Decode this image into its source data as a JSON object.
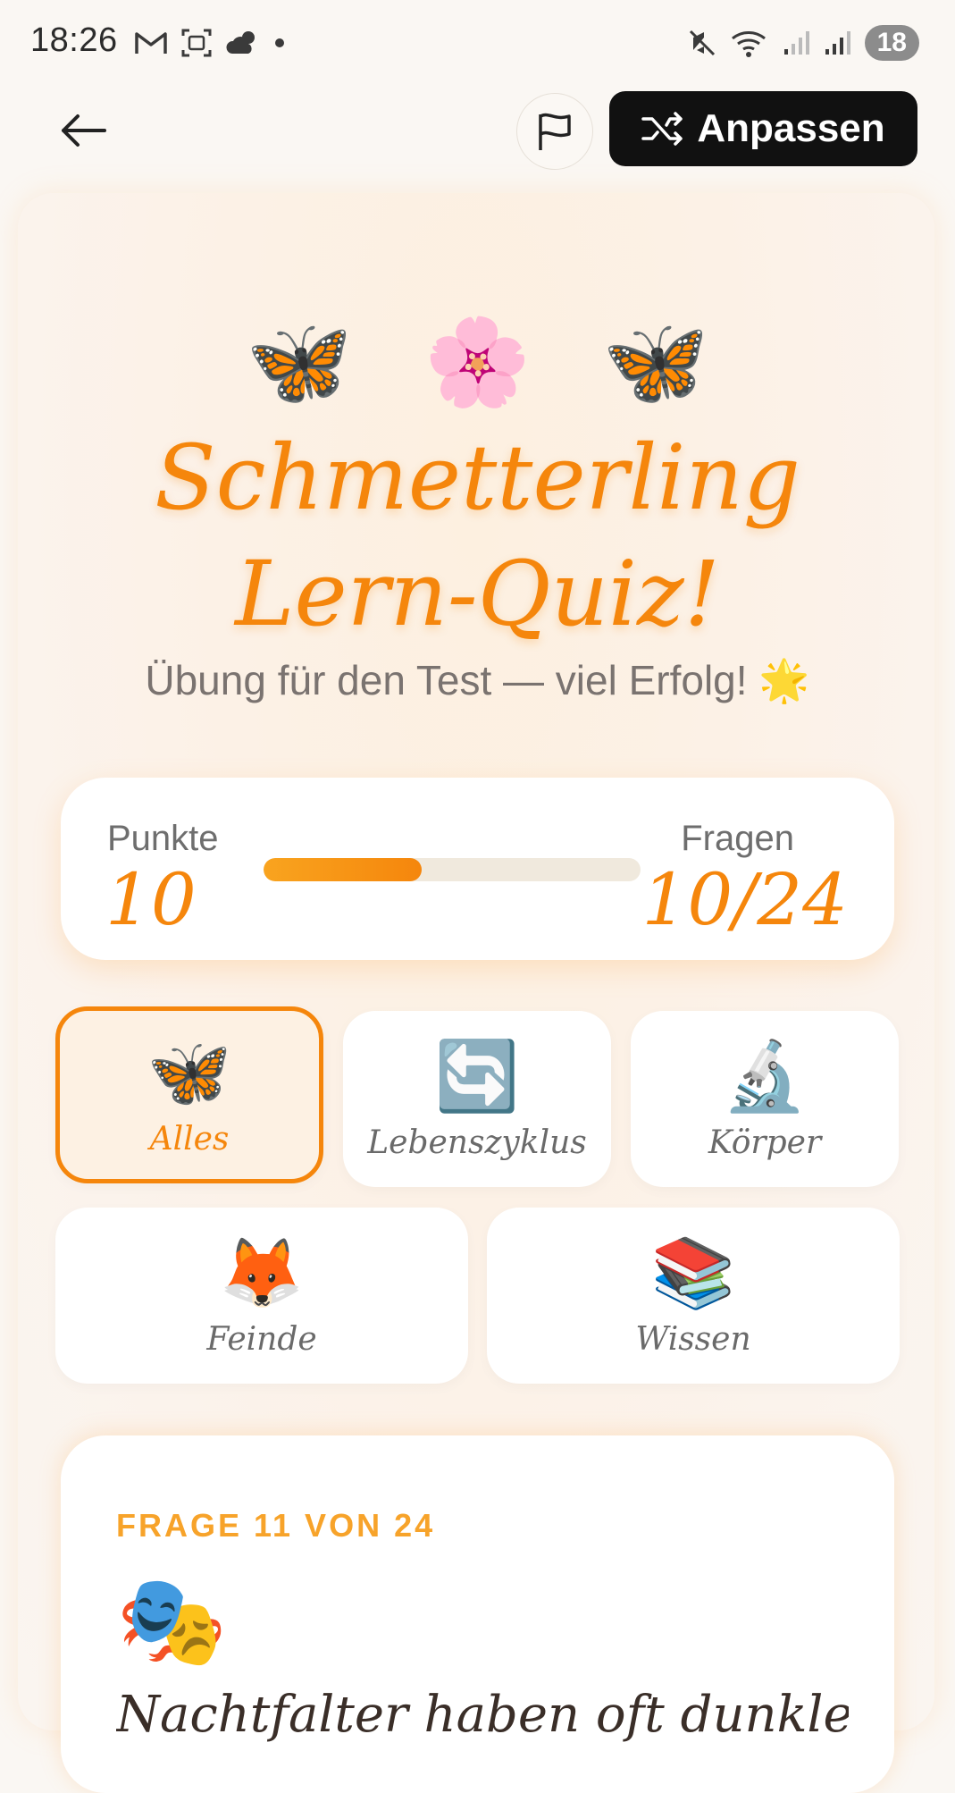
{
  "status_bar": {
    "time": "18:26",
    "battery": "18",
    "left_icons": [
      "gmail-icon",
      "screenshot-icon",
      "weather-icon",
      "dot-icon"
    ],
    "right_icons": [
      "mute-icon",
      "wifi-icon",
      "signal-icon",
      "signal-icon"
    ]
  },
  "topbar": {
    "customize_label": "Anpassen"
  },
  "hero": {
    "emojis": [
      "🦋",
      "🌸",
      "🦋"
    ],
    "title_line1": "Schmetterling",
    "title_line2": "Lern-Quiz!",
    "subtitle": "Übung für den Test — viel Erfolg! 🌟"
  },
  "score": {
    "points_label": "Punkte",
    "points_value": "10",
    "questions_label": "Fragen",
    "questions_value": "10/24",
    "progress_fraction": 0.42
  },
  "categories": [
    {
      "icon": "🦋",
      "label": "Alles",
      "selected": true
    },
    {
      "icon": "🔄",
      "label": "Lebenszyklus",
      "selected": false
    },
    {
      "icon": "🔬",
      "label": "Körper",
      "selected": false
    },
    {
      "icon": "🦊",
      "label": "Feinde",
      "selected": false
    },
    {
      "icon": "📚",
      "label": "Wissen",
      "selected": false
    }
  ],
  "question": {
    "counter": "FRAGE 11 VON 24",
    "emoji": "🎭",
    "text": "Nachtfalter haben oft dunkle"
  }
}
